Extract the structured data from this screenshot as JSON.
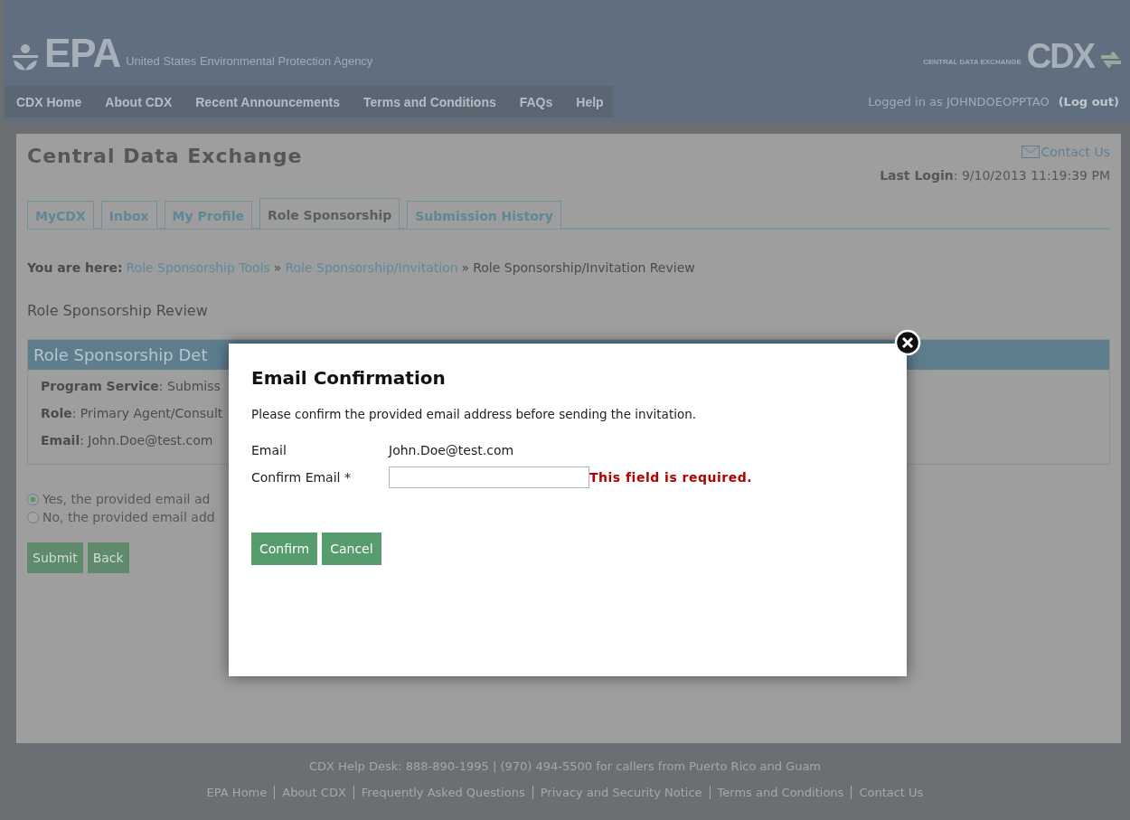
{
  "header": {
    "logo": "EPA",
    "agency": "United States Environmental Protection Agency",
    "cdx_caption": "CENTRAL DATA EXCHANGE",
    "cdx_logo": "CDX"
  },
  "nav": {
    "items": [
      "CDX Home",
      "About CDX",
      "Recent Announcements",
      "Terms and Conditions",
      "FAQs",
      "Help"
    ],
    "logged_in": "Logged in as JOHNDOEOPPTAO",
    "logout": "(Log out)"
  },
  "page": {
    "title": "Central Data Exchange",
    "contact": "Contact Us",
    "last_login_label": "Last Login",
    "last_login_value": ": 9/10/2013 11:19:39 PM",
    "tabs": [
      {
        "label": "MyCDX",
        "selected": false
      },
      {
        "label": "Inbox",
        "selected": false
      },
      {
        "label": "My Profile",
        "selected": false
      },
      {
        "label": "Role Sponsorship",
        "selected": true
      },
      {
        "label": "Submission History",
        "selected": false
      }
    ],
    "breadcrumb": {
      "label": "You are here:",
      "links": [
        "Role Sponsorship Tools",
        "Role Sponsorship/Invitation"
      ],
      "current": "Role Sponsorship/Invitation Review",
      "separator": "»"
    },
    "heading": "Role Sponsorship Review",
    "details": {
      "title": "Role Sponsorship Det",
      "rows": [
        {
          "label": "Program Service",
          "value": ": Submiss"
        },
        {
          "label": "Role",
          "value": ": Primary Agent/Consult"
        },
        {
          "label": "Email",
          "value": ": John.Doe@test.com"
        }
      ]
    },
    "options": [
      {
        "label": "Yes, the provided email ad",
        "selected": true
      },
      {
        "label": "No, the provided email add",
        "selected": false
      }
    ],
    "buttons": [
      "Submit",
      "Back"
    ]
  },
  "modal": {
    "title": "Email Confirmation",
    "message": "Please confirm the provided email address before sending the invitation.",
    "email_label": "Email",
    "email_value": "John.Doe@test.com",
    "confirm_label": "Confirm Email *",
    "error": "This field is required.",
    "buttons": [
      "Confirm",
      "Cancel"
    ]
  },
  "footer": {
    "help_desk": "CDX Help Desk: 888-890-1995 | (970) 494-5500 for callers from Puerto Rico and Guam",
    "links": [
      "EPA Home",
      "About CDX",
      "Frequently Asked Questions",
      "Privacy and Security Notice",
      "Terms and Conditions",
      "Contact Us"
    ]
  }
}
